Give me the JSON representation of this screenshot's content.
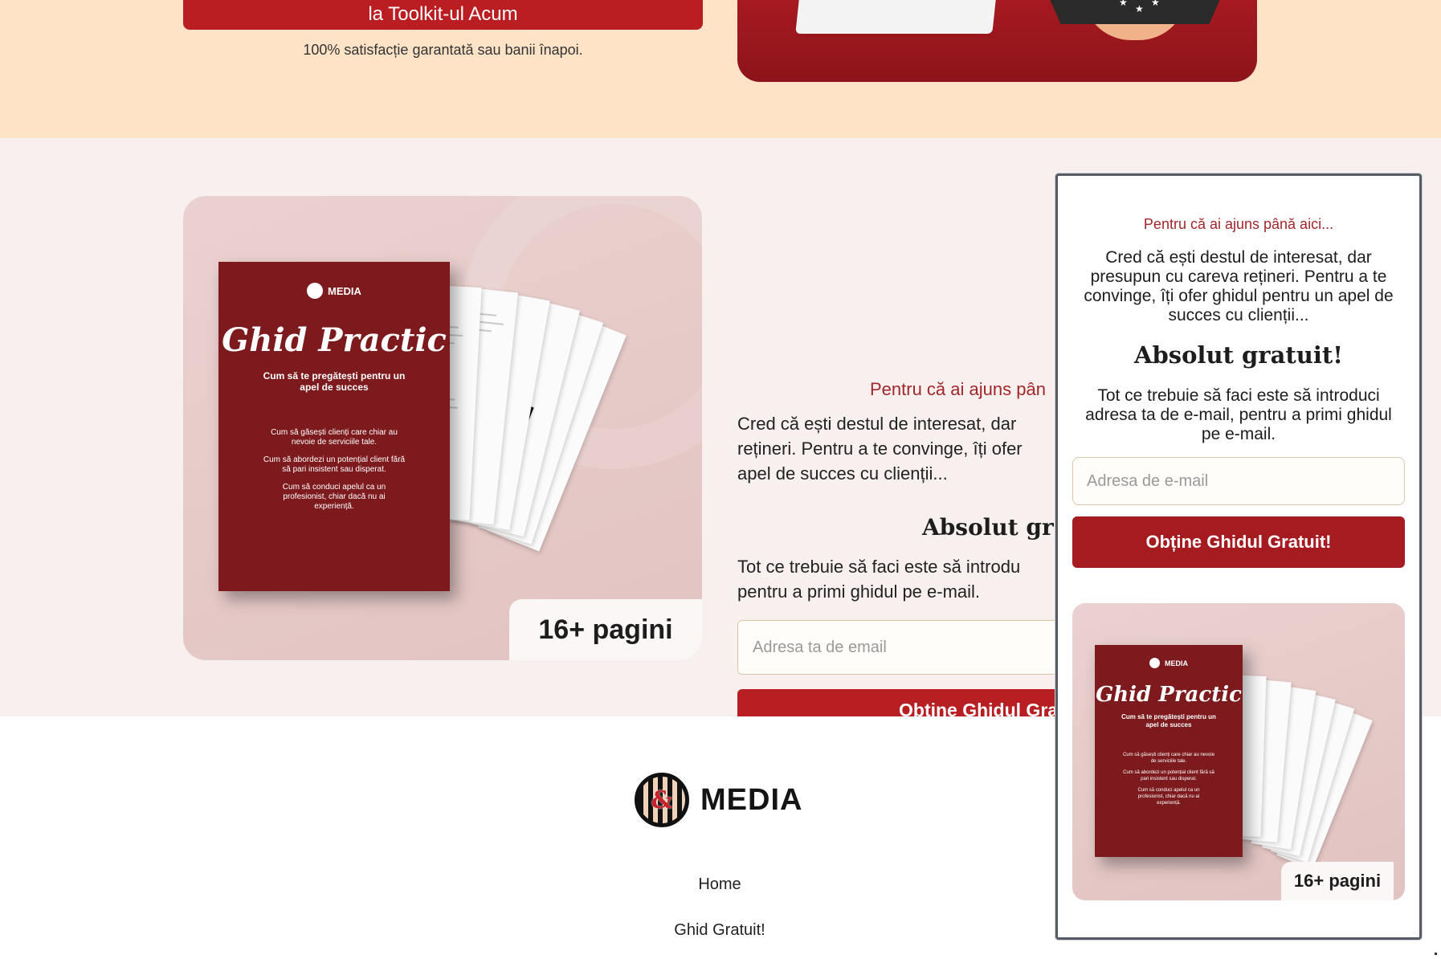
{
  "top_section": {
    "cta_label": "la Toolkit-ul Acum",
    "guarantee": "100% satisfacție garantată sau banii înapoi."
  },
  "promo": {
    "book": {
      "brand": "MEDIA",
      "title": "Ghid Practic",
      "subtitle": "Cum să te pregătești pentru un apel de succes",
      "bullets": [
        "Cum să găsești clienți care chiar au nevoie de serviciile tale.",
        "Cum să abordezi un potențial client fără să pari insistent sau disperat.",
        "Cum să conduci apelul ca un profesionist, chiar dacă nu ai experiență."
      ]
    },
    "pages_badge": "16+ pagini",
    "subhead": "Pentru că ai ajuns pân",
    "body": "Cred că ești destul de interesat, dar reținerI. Pentru a te convinge, îți ofer apel de succes cu clienții...",
    "body_lines": [
      "Cred că ești destul de interesat, dar",
      "rețineri. Pentru a te convinge, îți ofer",
      "apel de succes cu clienții..."
    ],
    "heading": "Absolut gratui",
    "body2_lines": [
      "Tot ce trebuie să faci este să introdu",
      "pentru a primi ghidul pe e-mail."
    ],
    "email_placeholder": "Adresa ta de email",
    "button_label": "Obține Ghidul Gra"
  },
  "footer": {
    "brand": "MEDIA",
    "logo_glyph": "&",
    "links": [
      "Home",
      "Ghid Gratuit!"
    ]
  },
  "popup": {
    "subhead": "Pentru că ai ajuns până aici...",
    "body": "Cred că ești destul de interesat, dar presupun cu careva rețineri. Pentru a te convinge, îți ofer ghidul pentru un apel de succes cu clienții...",
    "heading": "Absolut gratuit!",
    "body2": "Tot ce trebuie să faci este să introduci adresa ta de e-mail, pentru a primi ghidul pe e-mail.",
    "email_placeholder": "Adresa de e-mail",
    "button_label": "Obține Ghidul Gratuit!",
    "pages_badge": "16+ pagini"
  },
  "colors": {
    "accent_red": "#b81f22",
    "top_bg": "#ffe3c7",
    "mid_bg": "#f7f0ef",
    "subhead_red": "#a2262a"
  }
}
